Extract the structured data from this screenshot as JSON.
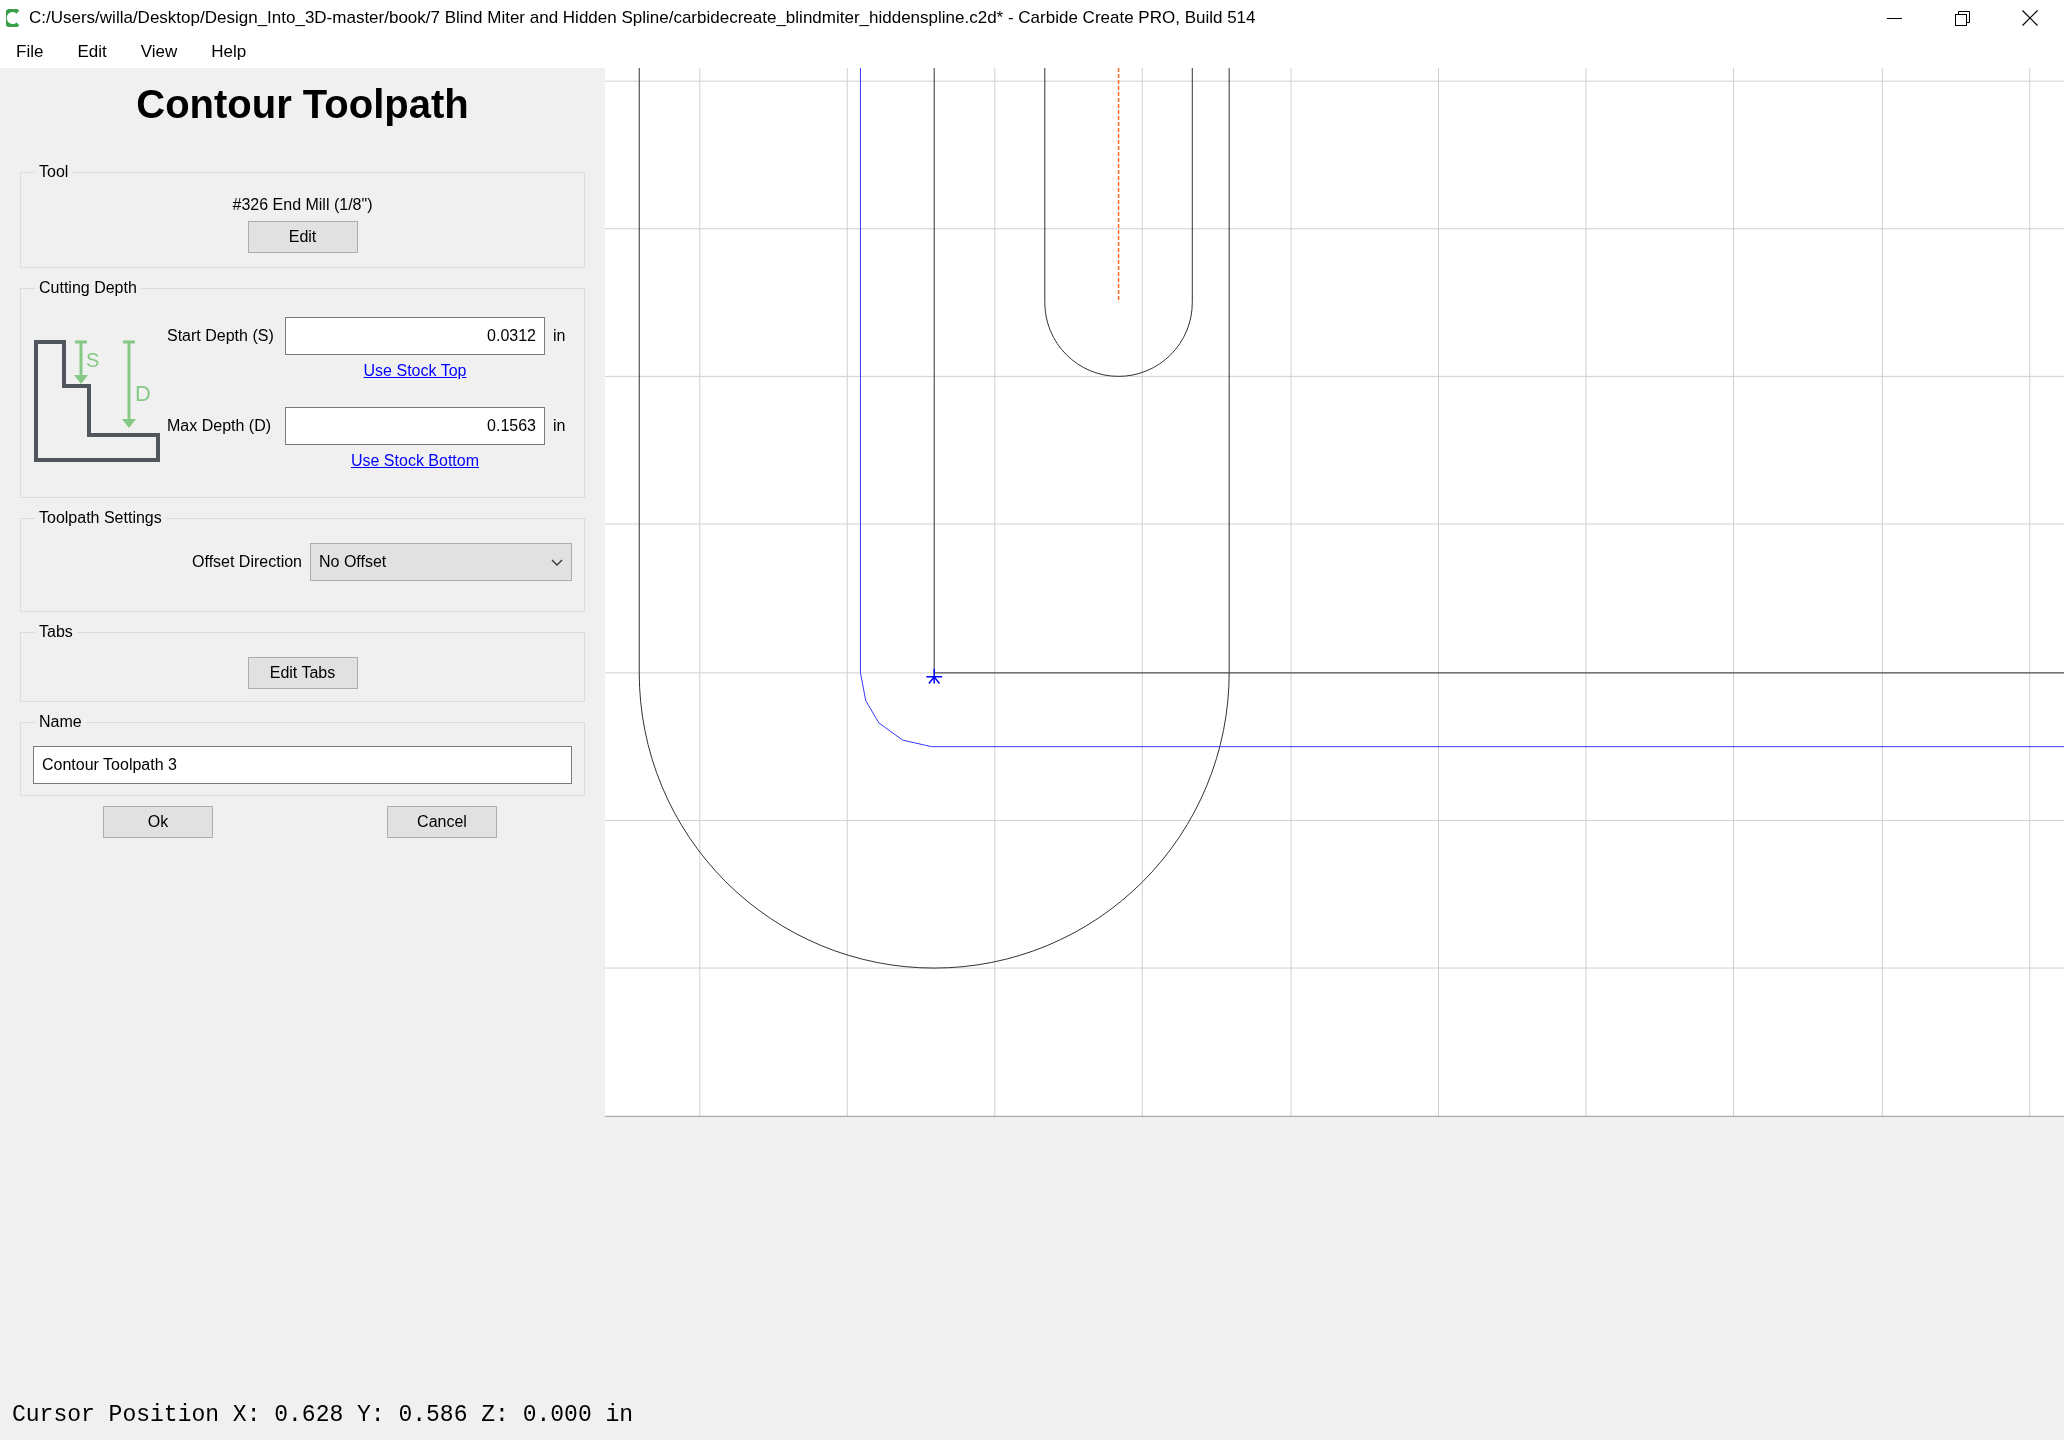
{
  "window": {
    "title": "C:/Users/willa/Desktop/Design_Into_3D-master/book/7 Blind Miter and Hidden Spline/carbidecreate_blindmiter_hiddenspline.c2d* - Carbide Create PRO, Build 514"
  },
  "menu": [
    "File",
    "Edit",
    "View",
    "Help"
  ],
  "panel": {
    "title": "Contour Toolpath",
    "tool_group": {
      "legend": "Tool",
      "tool_name": "#326 End Mill (1/8\")",
      "button": "Edit"
    },
    "depth_group": {
      "legend": "Cutting Depth",
      "diagram_labels": [
        "S",
        "D"
      ],
      "fields": [
        {
          "label": "Start Depth (S)",
          "value": "0.0312",
          "unit": "in",
          "link": "Use Stock Top"
        },
        {
          "label": "Max Depth (D)",
          "value": "0.1563",
          "unit": "in",
          "link": "Use Stock Bottom"
        }
      ]
    },
    "settings_group": {
      "legend": "Toolpath Settings",
      "label": "Offset Direction",
      "value": "No Offset"
    },
    "tabs_group": {
      "legend": "Tabs",
      "button": "Edit Tabs"
    },
    "name_group": {
      "legend": "Name",
      "value": "Contour Toolpath 3"
    },
    "buttons": [
      "Ok",
      "Cancel"
    ]
  },
  "status_bar": "Cursor Position X: 0.628 Y: 0.586 Z: 0.000 in"
}
